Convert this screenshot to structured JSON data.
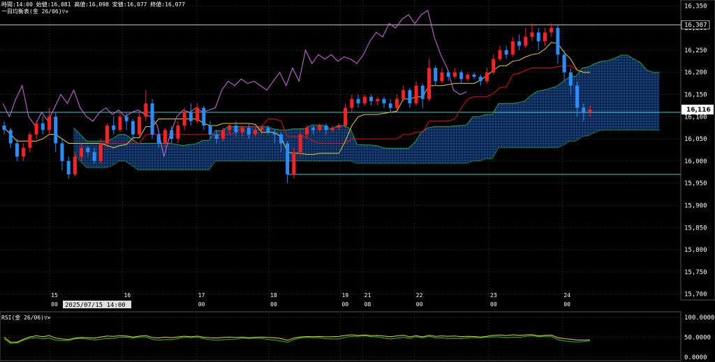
{
  "header": {
    "ohlc_text": "時間:14:00 始値:16,081 高値:16,098 安値:16,077 終値:16,077",
    "indicator_label": "一目均衡表(金 26/06)▽✕",
    "rsi_label": "RSI(金 26/06)▽✕"
  },
  "colors": {
    "background": "#000000",
    "grid": "#3a3a3a",
    "up_candle": "#ff2020",
    "down_candle": "#2a8cff",
    "kijun": "#e0101a",
    "tenkan": "#e8d020",
    "chikou": "#d070e0",
    "cloud": "#0a2a55",
    "span_line": "#20a040",
    "hline": "#40c8d0",
    "rsi_line1": "#e8d020",
    "rsi_line2": "#20c020"
  },
  "chart_data": [
    {
      "type": "line",
      "name": "price_panel",
      "ylim": [
        15690,
        16360
      ],
      "y_ticks": [
        "16,350",
        "16,300",
        "16,250",
        "16,200",
        "16,150",
        "16,100",
        "16,050",
        "16,000",
        "15,950",
        "15,900",
        "15,850",
        "15,800",
        "15,750",
        "15,700"
      ],
      "y_tick_values": [
        16350,
        16300,
        16250,
        16200,
        16150,
        16100,
        16050,
        16000,
        15950,
        15900,
        15850,
        15800,
        15750,
        15700
      ],
      "price_marker": "16,307",
      "price_marker_value": 16307,
      "current_price": "16,116",
      "current_price_value": 16116,
      "hlines": [
        16307,
        16110,
        15970
      ],
      "x_day_labels": [
        {
          "day": "15",
          "time": "00",
          "x": 0.073
        },
        {
          "day": "16",
          "time": "00",
          "x": 0.18
        },
        {
          "day": "17",
          "time": "00",
          "x": 0.289
        },
        {
          "day": "18",
          "time": "00",
          "x": 0.395
        },
        {
          "day": "19",
          "time": "00",
          "x": 0.5
        },
        {
          "day": "21",
          "time": "08",
          "x": 0.533
        },
        {
          "day": "22",
          "time": "00",
          "x": 0.609
        },
        {
          "day": "23",
          "time": "00",
          "x": 0.718
        },
        {
          "day": "24",
          "time": "00",
          "x": 0.826
        }
      ],
      "cursor_date": "2025/07/15 14:00",
      "candles": [
        [
          16080,
          16070,
          16090,
          16060
        ],
        [
          16070,
          16040,
          16075,
          16030
        ],
        [
          16040,
          16010,
          16050,
          16000
        ],
        [
          16010,
          16030,
          16040,
          16000
        ],
        [
          16030,
          16060,
          16065,
          16020
        ],
        [
          16060,
          16085,
          16090,
          16050
        ],
        [
          16085,
          16070,
          16100,
          16060
        ],
        [
          16070,
          16100,
          16120,
          16060
        ],
        [
          16100,
          16040,
          16110,
          16020
        ],
        [
          16040,
          16000,
          16050,
          15980
        ],
        [
          16000,
          15970,
          16010,
          15960
        ],
        [
          15970,
          16010,
          16020,
          15965
        ],
        [
          16010,
          16030,
          16040,
          16000
        ],
        [
          16030,
          16020,
          16035,
          16010
        ],
        [
          16020,
          16000,
          16030,
          15995
        ],
        [
          16000,
          16040,
          16050,
          15995
        ],
        [
          16040,
          16080,
          16085,
          16030
        ],
        [
          16080,
          16070,
          16100,
          16060
        ],
        [
          16070,
          16100,
          16110,
          16065
        ],
        [
          16100,
          16090,
          16110,
          16070
        ],
        [
          16090,
          16060,
          16095,
          16050
        ],
        [
          16060,
          16100,
          16110,
          16055
        ],
        [
          16100,
          16130,
          16160,
          16090
        ],
        [
          16130,
          16060,
          16140,
          16050
        ],
        [
          16060,
          16040,
          16070,
          16030
        ],
        [
          16040,
          16070,
          16075,
          16030
        ],
        [
          16070,
          16050,
          16080,
          16040
        ],
        [
          16050,
          16080,
          16090,
          16040
        ],
        [
          16080,
          16110,
          16120,
          16070
        ],
        [
          16110,
          16090,
          16130,
          16080
        ],
        [
          16090,
          16120,
          16130,
          16085
        ],
        [
          16120,
          16080,
          16125,
          16070
        ],
        [
          16080,
          16060,
          16090,
          16050
        ],
        [
          16060,
          16050,
          16070,
          16040
        ],
        [
          16050,
          16070,
          16075,
          16045
        ],
        [
          16070,
          16080,
          16085,
          16060
        ],
        [
          16080,
          16065,
          16090,
          16055
        ],
        [
          16065,
          16075,
          16080,
          16055
        ],
        [
          16075,
          16060,
          16085,
          16050
        ],
        [
          16060,
          16070,
          16075,
          16055
        ],
        [
          16070,
          16075,
          16080,
          16060
        ],
        [
          16075,
          16065,
          16080,
          16060
        ],
        [
          16065,
          16060,
          16070,
          16040
        ],
        [
          16060,
          16040,
          16065,
          16020
        ],
        [
          16040,
          15970,
          16045,
          15950
        ],
        [
          15970,
          16020,
          16030,
          15960
        ],
        [
          16020,
          16060,
          16070,
          16010
        ],
        [
          16060,
          16075,
          16080,
          16050
        ],
        [
          16075,
          16070,
          16080,
          16060
        ],
        [
          16070,
          16080,
          16085,
          16065
        ],
        [
          16080,
          16070,
          16085,
          16060
        ],
        [
          16070,
          16075,
          16080,
          16065
        ],
        [
          16075,
          16080,
          16085,
          16070
        ],
        [
          16080,
          16120,
          16130,
          16075
        ],
        [
          16120,
          16140,
          16150,
          16110
        ],
        [
          16140,
          16130,
          16150,
          16120
        ],
        [
          16130,
          16145,
          16150,
          16125
        ],
        [
          16145,
          16135,
          16150,
          16125
        ],
        [
          16135,
          16140,
          16145,
          16125
        ],
        [
          16140,
          16130,
          16145,
          16120
        ],
        [
          16130,
          16120,
          16140,
          16110
        ],
        [
          16120,
          16140,
          16150,
          16115
        ],
        [
          16140,
          16160,
          16170,
          16135
        ],
        [
          16160,
          16130,
          16165,
          16120
        ],
        [
          16130,
          16170,
          16180,
          16125
        ],
        [
          16170,
          16140,
          16175,
          16120
        ],
        [
          16140,
          16210,
          16230,
          16135
        ],
        [
          16210,
          16180,
          16215,
          16170
        ],
        [
          16180,
          16200,
          16210,
          16175
        ],
        [
          16200,
          16190,
          16205,
          16180
        ],
        [
          16190,
          16200,
          16210,
          16185
        ],
        [
          16200,
          16185,
          16205,
          16175
        ],
        [
          16185,
          16195,
          16200,
          16180
        ],
        [
          16195,
          16190,
          16200,
          16185
        ],
        [
          16190,
          16180,
          16195,
          16170
        ],
        [
          16180,
          16200,
          16210,
          16175
        ],
        [
          16200,
          16230,
          16240,
          16195
        ],
        [
          16230,
          16250,
          16260,
          16225
        ],
        [
          16250,
          16240,
          16260,
          16230
        ],
        [
          16240,
          16270,
          16280,
          16235
        ],
        [
          16270,
          16260,
          16285,
          16250
        ],
        [
          16260,
          16280,
          16300,
          16255
        ],
        [
          16280,
          16290,
          16310,
          16270
        ],
        [
          16290,
          16270,
          16300,
          16250
        ],
        [
          16270,
          16290,
          16300,
          16260
        ],
        [
          16290,
          16300,
          16310,
          16280
        ],
        [
          16300,
          16240,
          16305,
          16220
        ],
        [
          16240,
          16200,
          16250,
          16180
        ],
        [
          16200,
          16170,
          16210,
          16150
        ],
        [
          16170,
          16120,
          16180,
          16100
        ],
        [
          16120,
          16110,
          16130,
          16090
        ],
        [
          16110,
          16116,
          16125,
          16100
        ]
      ]
    },
    {
      "type": "line",
      "name": "rsi_panel",
      "ylim": [
        0,
        100
      ],
      "y_ticks": [
        "100.0000",
        "50.0000",
        "0.0000"
      ],
      "y_tick_values": [
        100,
        50,
        0
      ]
    }
  ]
}
